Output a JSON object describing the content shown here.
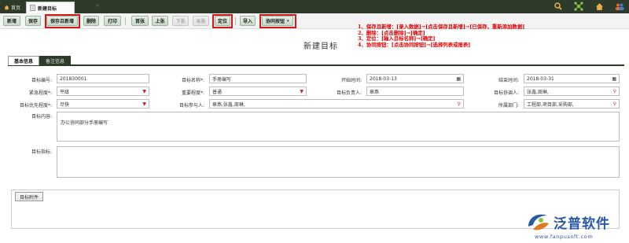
{
  "tabs": {
    "home": "首页",
    "active": "新建目标",
    "close": "×"
  },
  "top_icons": [
    "search-icon",
    "network-icon",
    "home-icon",
    "users-icon"
  ],
  "toolbar": {
    "new": "新增",
    "save": "保存",
    "save_new": "保存且新增",
    "delete": "删除",
    "print": "打印",
    "first": "首张",
    "prev": "上张",
    "next": "下张",
    "last": "末张",
    "locate": "定位",
    "import": "导入",
    "collab": "协同按钮"
  },
  "annotations": [
    "1、保存且新增：[录入数据]→[点击保存且新增]→[已保存，重新添加数据]",
    "2、删除：[点击删除]→[确定]",
    "3、定位：[输入目标名称]→[确定]",
    "4、协同按钮：[点击协同按钮]→[选择列表或报表]"
  ],
  "page_title": "新建目标",
  "inner_tabs": {
    "basic": "基本信息",
    "remark": "备注信息"
  },
  "form": {
    "code_label": "目标编号:",
    "code_value": "201830001",
    "name_label": "目标名称*:",
    "name_value": "手册编写",
    "start_label": "开始时间:",
    "start_value": "2018-03-13",
    "end_label": "结束时间:",
    "end_value": "2018-03-31",
    "urgency_label": "紧急程度*:",
    "urgency_value": "平级",
    "importance_label": "重要程度*:",
    "importance_value": "普通",
    "owner_label": "目标负责人:",
    "owner_value": "章燕",
    "coordinator_label": "目标协调人:",
    "coordinator_value": "张鑫,周琳,",
    "priority_label": "目标优先程度*:",
    "priority_value": "尽快",
    "participants_label": "目标参与人:",
    "participants_value": "章燕,张鑫,周琳,",
    "department_label": "所属部门:",
    "department_value": "工程部,项目部,采购部,",
    "content_label": "目标内容:",
    "content_value": "办公协同部分手册编写",
    "indicator_label": "目标指标:",
    "indicator_value": ""
  },
  "attachment_tab": "目标附件",
  "logo": {
    "text": "泛普软件",
    "url": "www.fanpusoft.com"
  },
  "colors": {
    "topbar": "#2f3b2a",
    "highlight": "#d81818",
    "annotation": "#e00000",
    "logo": "#2a57a8"
  }
}
